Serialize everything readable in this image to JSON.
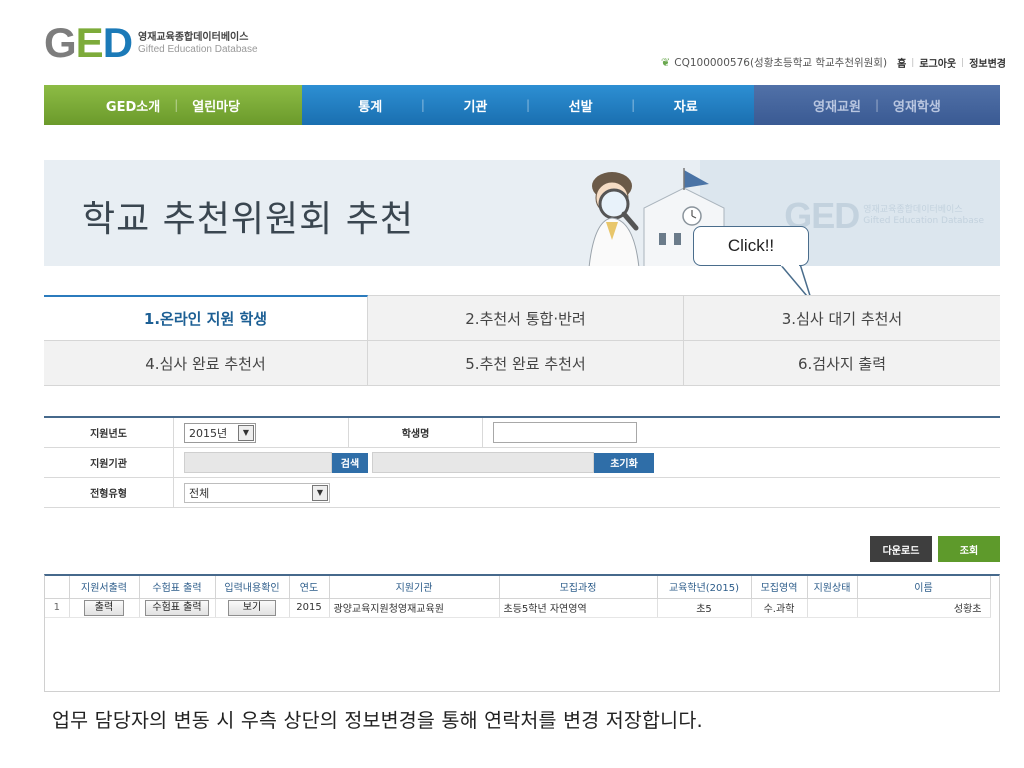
{
  "logo": {
    "mark": "GED",
    "kr": "영재교육종합데이터베이스",
    "en": "Gifted Education Database"
  },
  "topbar": {
    "user": "CQ100000576(성황초등학교 학교추천위원회)",
    "home": "홈",
    "logout": "로그아웃",
    "info_change": "정보변경"
  },
  "nav": {
    "green": [
      "GED소개",
      "열린마당"
    ],
    "blue": [
      "통계",
      "기관",
      "선발",
      "자료"
    ],
    "dark": [
      "영재교원",
      "영재학생"
    ]
  },
  "banner": {
    "title": "학교 추천위원회 추천",
    "logo_mark": "GED",
    "logo_kr": "영재교육종합데이터베이스",
    "logo_en": "Gifted Education Database"
  },
  "callout": "Click!!",
  "tabs": [
    "1.온라인 지원 학생",
    "2.추천서 통합·반려",
    "3.심사 대기 추천서",
    "4.심사 완료 추천서",
    "5.추천 완료 추천서",
    "6.검사지 출력"
  ],
  "form": {
    "year_label": "지원년도",
    "year_value": "2015년",
    "student_label": "학생명",
    "student_value": "",
    "agency_label": "지원기관",
    "search_btn": "검색",
    "reset_btn": "초기화",
    "type_label": "전형유형",
    "type_value": "전체"
  },
  "actions": {
    "download": "다운로드",
    "query": "조회"
  },
  "table": {
    "headers": [
      "지원서출력",
      "수험표 출력",
      "입력내용확인",
      "연도",
      "지원기관",
      "모집과정",
      "교육학년(2015)",
      "모집영역",
      "지원상태",
      "이름"
    ],
    "rows": [
      {
        "num": "1",
        "print_btn": "출력",
        "ticket_btn": "수험표 출력",
        "view_btn": "보기",
        "year": "2015",
        "agency": "광양교육지원청영재교육원",
        "course": "초등5학년 자연영역",
        "grade": "초5",
        "field": "수.과학",
        "status": "",
        "name": "성황초"
      }
    ]
  },
  "caption": "업무 담당자의 변동 시 우측 상단의 정보변경을 통해 연락처를 변경 저장합니다.",
  "colors": {
    "nav_green": "#7aab38",
    "nav_blue": "#2384c8",
    "nav_dark": "#4565a0",
    "active_tab": "#1c5f94",
    "table_header_border": "#46698c"
  }
}
